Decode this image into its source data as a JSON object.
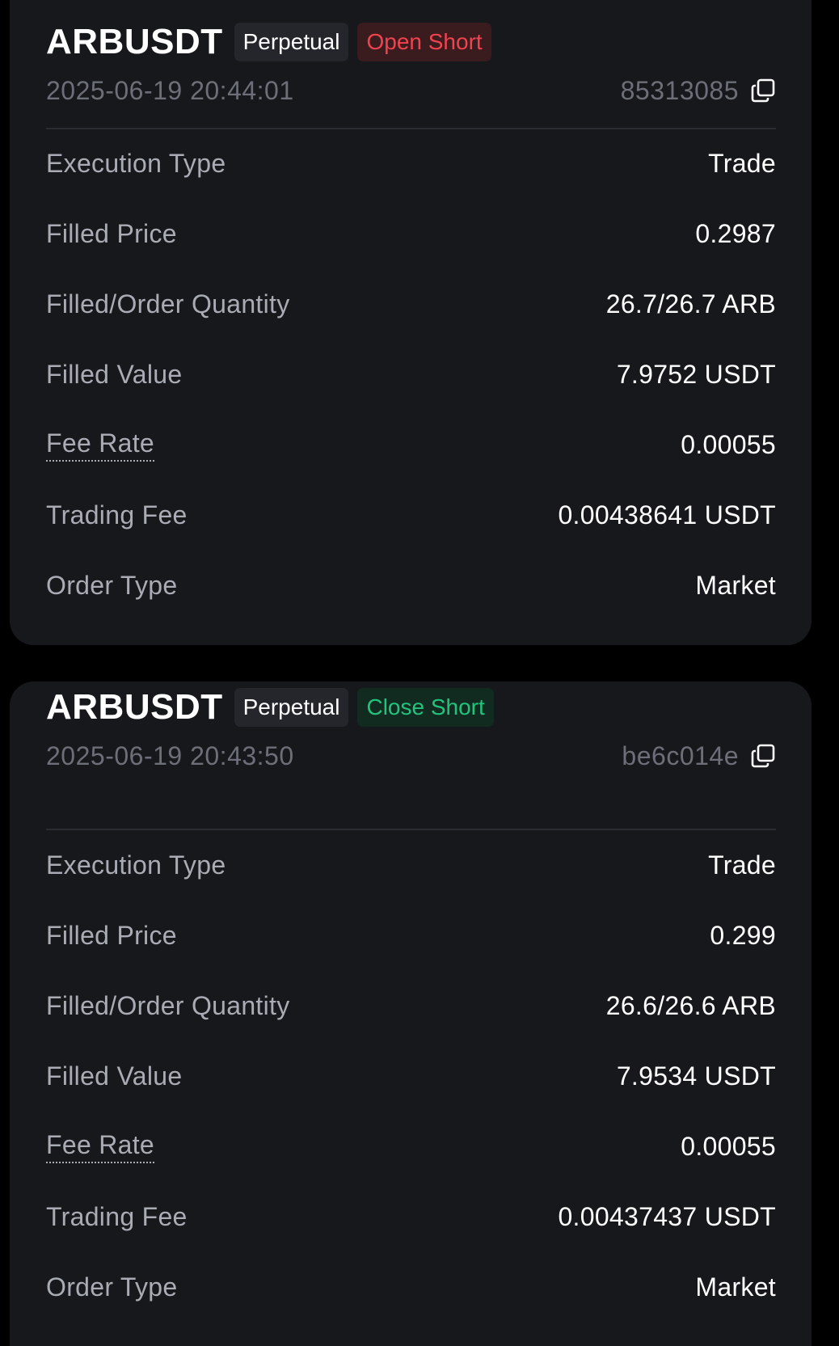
{
  "colors": {
    "background": "#000000",
    "card": "#17181c",
    "open_short": "#f0434f",
    "close_short": "#22c47d",
    "muted_text": "#6c6f78",
    "label_text": "#a9acb4"
  },
  "records": [
    {
      "symbol": "ARBUSDT",
      "contract_tag": "Perpetual",
      "side_tag": "Open Short",
      "time": "2025-06-19 20:44:01",
      "order_id": "85313085",
      "copy_icon": "copy-icon",
      "fields": {
        "execution_type": {
          "label": "Execution Type",
          "value": "Trade"
        },
        "filled_price": {
          "label": "Filled Price",
          "value": "0.2987"
        },
        "filled_order_quantity": {
          "label": "Filled/Order Quantity",
          "value": "26.7/26.7 ARB"
        },
        "filled_value": {
          "label": "Filled Value",
          "value": "7.9752 USDT"
        },
        "fee_rate": {
          "label": "Fee Rate",
          "value": "0.00055"
        },
        "trading_fee": {
          "label": "Trading Fee",
          "value": "0.00438641 USDT"
        },
        "order_type": {
          "label": "Order Type",
          "value": "Market"
        }
      }
    },
    {
      "symbol": "ARBUSDT",
      "contract_tag": "Perpetual",
      "side_tag": "Close Short",
      "time": "2025-06-19 20:43:50",
      "order_id": "be6c014e",
      "copy_icon": "copy-icon",
      "fields": {
        "execution_type": {
          "label": "Execution Type",
          "value": "Trade"
        },
        "filled_price": {
          "label": "Filled Price",
          "value": "0.299"
        },
        "filled_order_quantity": {
          "label": "Filled/Order Quantity",
          "value": "26.6/26.6 ARB"
        },
        "filled_value": {
          "label": "Filled Value",
          "value": "7.9534 USDT"
        },
        "fee_rate": {
          "label": "Fee Rate",
          "value": "0.00055"
        },
        "trading_fee": {
          "label": "Trading Fee",
          "value": "0.00437437 USDT"
        },
        "order_type": {
          "label": "Order Type",
          "value": "Market"
        }
      }
    }
  ]
}
